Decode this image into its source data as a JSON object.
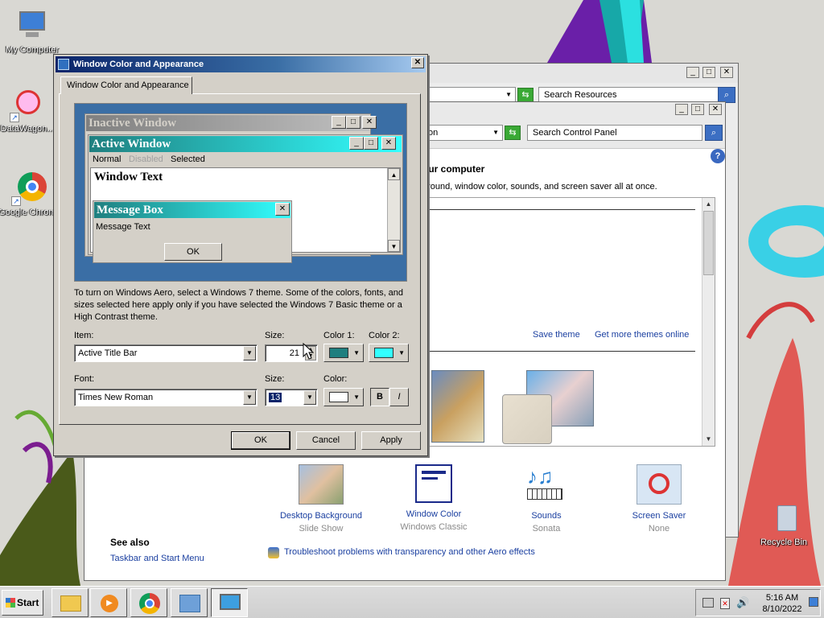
{
  "desktop": {
    "icons": [
      {
        "label": "My Computer"
      },
      {
        "label": "DataWagon..."
      },
      {
        "label": "Google Chrome"
      },
      {
        "label": "Recycle Bin"
      }
    ]
  },
  "back_window": {
    "search_placeholder": "Search Resources"
  },
  "control_panel": {
    "address_partial": "on",
    "search_placeholder": "Search Control Panel",
    "heading": "our computer",
    "description": "ground, window color, sounds, and screen saver all at once.",
    "save_theme": "Save theme",
    "get_more_themes": "Get more themes online",
    "tiles": [
      {
        "title": "Desktop Background",
        "subtitle": "Slide Show"
      },
      {
        "title": "Window Color",
        "subtitle": "Windows Classic"
      },
      {
        "title": "Sounds",
        "subtitle": "Sonata"
      },
      {
        "title": "Screen Saver",
        "subtitle": "None"
      }
    ],
    "see_also": "See also",
    "taskbar_link": "Taskbar and Start Menu",
    "troubleshoot_link": "Troubleshoot problems with transparency and other Aero effects"
  },
  "dialog": {
    "title": "Window Color and Appearance",
    "tab": "Window Color and Appearance",
    "preview": {
      "inactive_title": "Inactive Window",
      "active_title": "Active Window",
      "menu_normal": "Normal",
      "menu_disabled": "Disabled",
      "menu_selected": "Selected",
      "window_text": "Window Text",
      "msgbox_title": "Message Box",
      "msgbox_text": "Message Text",
      "msgbox_ok": "OK"
    },
    "info_text": "To turn on Windows Aero, select a Windows 7 theme.  Some of the colors, fonts, and sizes selected here apply only if you have selected the Windows 7 Basic theme or a High Contrast theme.",
    "item_label": "Item:",
    "item_value": "Active Title Bar",
    "item_size_label": "Size:",
    "item_size_value": "21",
    "color1_label": "Color 1:",
    "color2_label": "Color 2:",
    "color1": "#1f7f7f",
    "color2": "#33ffff",
    "font_label": "Font:",
    "font_value": "Times New Roman",
    "font_size_label": "Size:",
    "font_size_value": "13",
    "font_color_label": "Color:",
    "font_color": "#ffffff",
    "bold": "B",
    "italic": "I",
    "ok": "OK",
    "cancel": "Cancel",
    "apply": "Apply"
  },
  "taskbar": {
    "start": "Start",
    "time": "5:16 AM",
    "date": "8/10/2022"
  }
}
